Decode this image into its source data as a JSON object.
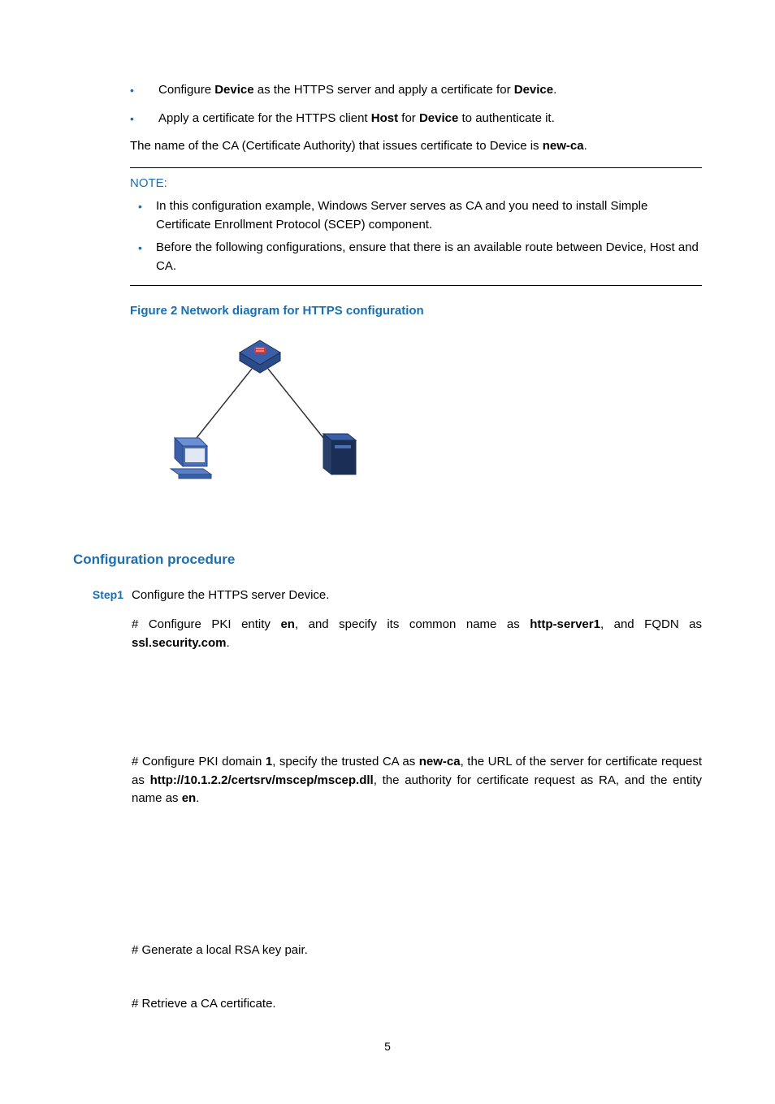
{
  "bullets": [
    {
      "before": "Configure ",
      "b1": "Device",
      "mid": " as the HTTPS server and apply a certificate for ",
      "b2": "Device",
      "after": "."
    },
    {
      "before": "Apply a certificate for the HTTPS client ",
      "b1": "Host",
      "mid": " for ",
      "b2": "Device",
      "after": " to authenticate it."
    }
  ],
  "ca_para": {
    "before": "The name of the CA (Certificate Authority) that issues certificate to Device is ",
    "bold": "new-ca",
    "after": "."
  },
  "note": {
    "label": "NOTE:",
    "items": [
      "In this configuration example, Windows Server serves as CA and you need to install Simple Certificate Enrollment Protocol (SCEP) component.",
      "Before the following configurations, ensure that there is an available route between Device, Host and CA."
    ]
  },
  "figure_caption": "Figure 2 Network diagram for HTTPS configuration",
  "section_header": "Configuration procedure",
  "step1": {
    "label": "Step1",
    "text": "Configure the HTTPS server Device."
  },
  "pki_entity": {
    "t1": "# Configure PKI entity ",
    "b1": "en",
    "t2": ", and specify its common name as ",
    "b2": "http-server1",
    "t3": ", and FQDN as ",
    "b3": "ssl.security.com",
    "t4": "."
  },
  "pki_domain": {
    "t1": "# Configure PKI domain ",
    "b1": "1",
    "t2": ", specify the trusted CA as ",
    "b2": "new-ca",
    "t3": ", the URL of the server for certificate request as ",
    "b3": "http://10.1.2.2/certsrv/mscep/mscep.dll",
    "t4": ", the authority for certificate request as RA, and the entity name as ",
    "b4": "en",
    "t5": "."
  },
  "rsa_para": "# Generate a local RSA key pair.",
  "ca_cert_para": "# Retrieve a CA certificate.",
  "page_number": "5"
}
